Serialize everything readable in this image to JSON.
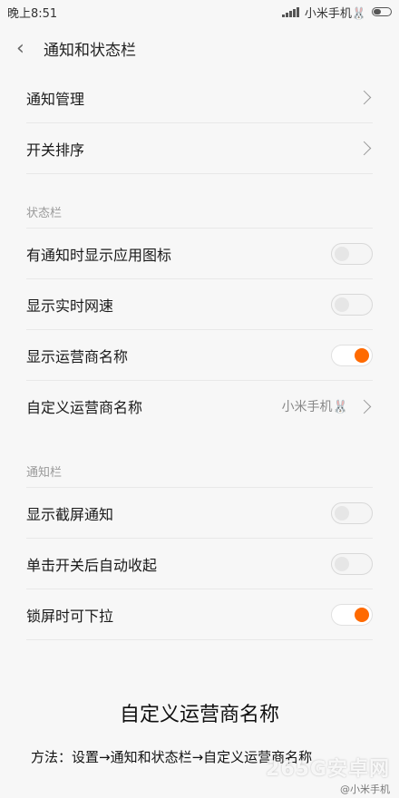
{
  "status_bar": {
    "time": "晚上8:51",
    "carrier": "小米手机🐰"
  },
  "header": {
    "title": "通知和状态栏"
  },
  "top_items": [
    {
      "label": "通知管理"
    },
    {
      "label": "开关排序"
    }
  ],
  "status_section": {
    "title": "状态栏",
    "items": [
      {
        "label": "有通知时显示应用图标",
        "on": false
      },
      {
        "label": "显示实时网速",
        "on": false
      },
      {
        "label": "显示运营商名称",
        "on": true
      },
      {
        "label": "自定义运营商名称",
        "value": "小米手机🐰"
      }
    ]
  },
  "notify_section": {
    "title": "通知栏",
    "items": [
      {
        "label": "显示截屏通知",
        "on": false
      },
      {
        "label": "单击开关后自动收起",
        "on": false
      },
      {
        "label": "锁屏时可下拉",
        "on": true
      }
    ]
  },
  "caption": {
    "title": "自定义运营商名称",
    "method": "方法：设置→通知和状态栏→自定义运营商名称"
  },
  "watermark": {
    "text": "265G安卓网",
    "weibo": "@小米手机"
  },
  "colors": {
    "accent": "#ff6a00"
  }
}
